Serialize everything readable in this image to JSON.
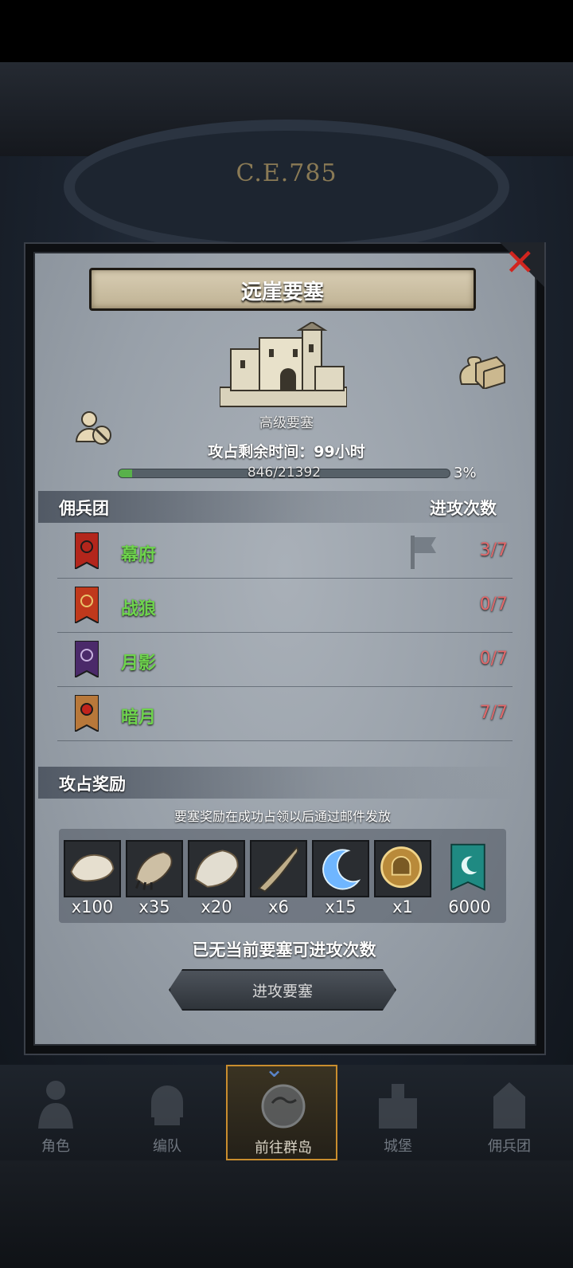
{
  "background": {
    "era": "C.E.785"
  },
  "modal": {
    "title": "远崖要塞",
    "fortress_type": "高级要塞",
    "timer": "攻占剩余时间：99小时",
    "progress": {
      "text": "846/21392",
      "percent_label": "3%",
      "fraction": 0.04
    },
    "mercenary_section": {
      "title": "佣兵团",
      "attempts_header": "进攻次数",
      "rows": [
        {
          "name": "幕府",
          "attempts": "3/7",
          "banner_color": "#b3261c"
        },
        {
          "name": "战狼",
          "attempts": "0/7",
          "banner_color": "#c0391c"
        },
        {
          "name": "月影",
          "attempts": "0/7",
          "banner_color": "#4b2a6a"
        },
        {
          "name": "暗月",
          "attempts": "7/7",
          "banner_color": "#b8783a"
        }
      ]
    },
    "reward_section": {
      "title": "攻占奖励",
      "note": "要塞奖励在成功占领以后通过邮件发放",
      "items": [
        {
          "icon": "fur-pelt-icon",
          "qty": "x100"
        },
        {
          "icon": "beast-claw-icon",
          "qty": "x35"
        },
        {
          "icon": "white-pelt-icon",
          "qty": "x20"
        },
        {
          "icon": "horn-icon",
          "qty": "x6"
        },
        {
          "icon": "blue-crescent-icon",
          "qty": "x15"
        },
        {
          "icon": "golden-helmet-icon",
          "qty": "x1"
        },
        {
          "icon": "teal-banner-icon",
          "qty": "6000"
        }
      ]
    },
    "status": "已无当前要塞可进攻次数",
    "attack_button": "进攻要塞"
  },
  "bottom_nav": [
    {
      "label": "角色"
    },
    {
      "label": "编队"
    },
    {
      "label": "前往群岛",
      "active": true
    },
    {
      "label": "城堡"
    },
    {
      "label": "佣兵团"
    }
  ],
  "colors": {
    "accent_green": "#6ed34d",
    "count_red": "#e0686a",
    "close_red": "#d1251f",
    "nav_active_border": "#c98d2e"
  }
}
